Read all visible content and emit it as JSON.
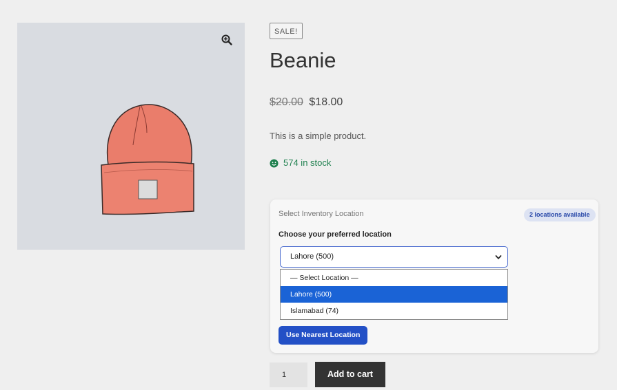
{
  "product": {
    "sale_badge": "SALE!",
    "title": "Beanie",
    "regular_price": "$20.00",
    "sale_price": "$18.00",
    "short_description": "This is a simple product.",
    "stock_text": "574 in stock"
  },
  "inventory": {
    "heading": "Select Inventory Location",
    "badge": "2 locations available",
    "choose_label": "Choose your preferred location",
    "selected_value": "Lahore (500)",
    "options": [
      "— Select Location —",
      "Lahore (500)",
      "Islamabad (74)"
    ],
    "selected_index": 1,
    "nearest_button": "Use Nearest Location"
  },
  "cart": {
    "quantity": "1",
    "add_button": "Add to cart"
  },
  "colors": {
    "stock_green": "#1d7f4d",
    "selected_option": "#1a63d6",
    "primary_button": "#2350c6",
    "badge_text": "#2747a8"
  },
  "icons": {
    "zoom": "magnifier-plus-icon",
    "stock": "smile-icon",
    "select_chevron": "chevron-down-icon"
  }
}
